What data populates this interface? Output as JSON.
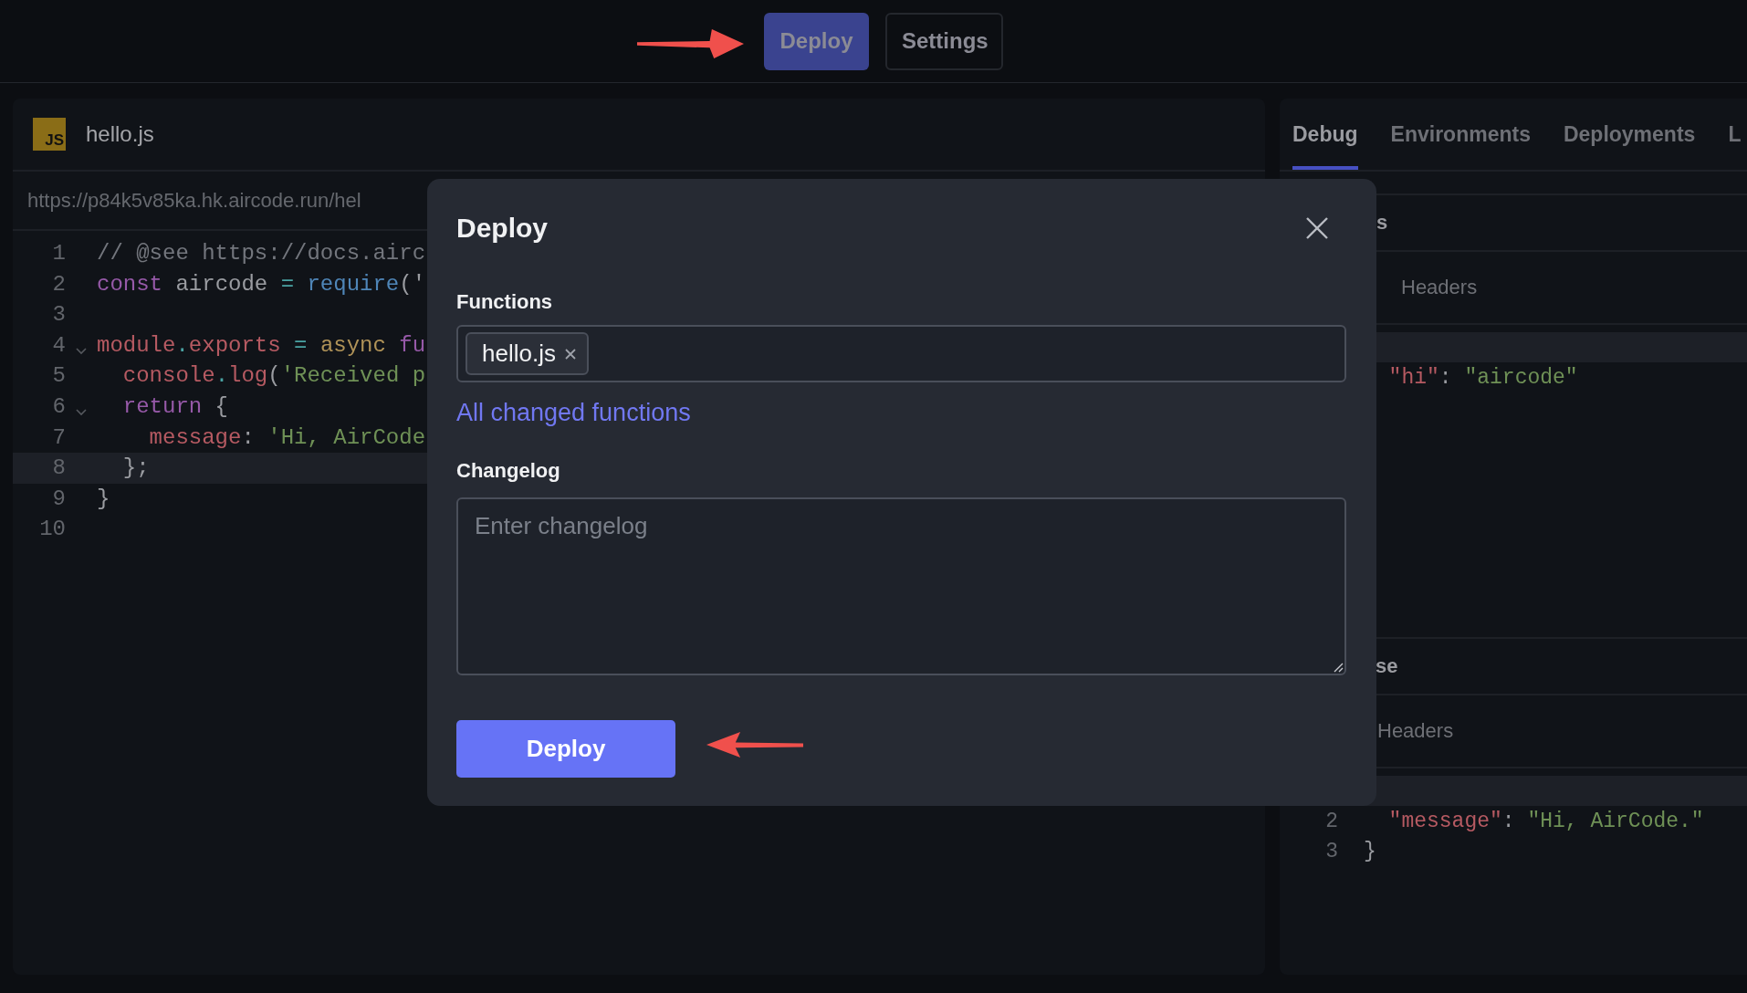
{
  "toolbar": {
    "buttons": [
      {
        "label": "Deploy",
        "kind": "primary"
      },
      {
        "label": "Settings",
        "kind": "secondary"
      }
    ]
  },
  "editor": {
    "file": {
      "icon_label": "JS",
      "name": "hello.js"
    },
    "url": "https://p84k5v85ka.hk.aircode.run/hel",
    "lines": [
      {
        "number": "1",
        "tokens": [
          {
            "text": "// @see https://docs.airc",
            "kind": "comment"
          }
        ]
      },
      {
        "number": "2",
        "tokens": [
          {
            "text": "const",
            "kind": "keyword"
          },
          {
            "text": " aircode ",
            "kind": "plain"
          },
          {
            "text": "= ",
            "kind": "operator"
          },
          {
            "text": "require",
            "kind": "call"
          },
          {
            "text": "('",
            "kind": "plain"
          }
        ]
      },
      {
        "number": "3"
      },
      {
        "number": "4",
        "fold": true,
        "tokens": [
          {
            "text": "module",
            "kind": "member"
          },
          {
            "text": ".",
            "kind": "operator"
          },
          {
            "text": "exports",
            "kind": "member"
          },
          {
            "text": " = ",
            "kind": "operator"
          },
          {
            "text": "async",
            "kind": "async"
          },
          {
            "text": " fu",
            "kind": "keyword"
          }
        ]
      },
      {
        "number": "5",
        "tokens": [
          {
            "text": "  console",
            "kind": "member"
          },
          {
            "text": ".",
            "kind": "operator"
          },
          {
            "text": "log",
            "kind": "member"
          },
          {
            "text": "(",
            "kind": "plain"
          },
          {
            "text": "'Received p",
            "kind": "string"
          }
        ]
      },
      {
        "number": "6",
        "fold": true,
        "tokens": [
          {
            "text": "  return",
            "kind": "keyword"
          },
          {
            "text": " {",
            "kind": "plain"
          }
        ]
      },
      {
        "number": "7",
        "tokens": [
          {
            "text": "    message",
            "kind": "member"
          },
          {
            "text": ": ",
            "kind": "plain"
          },
          {
            "text": "'Hi, AirCode",
            "kind": "string"
          }
        ]
      },
      {
        "number": "8",
        "active": true,
        "tokens": [
          {
            "text": "  };",
            "kind": "plain"
          }
        ]
      },
      {
        "number": "9",
        "tokens": [
          {
            "text": "}",
            "kind": "plain"
          }
        ]
      },
      {
        "number": "10"
      }
    ]
  },
  "side_panel": {
    "tabs": [
      {
        "label": "Debug",
        "selected": true
      },
      {
        "label": "Environments",
        "selected": false
      },
      {
        "label": "Deployments",
        "selected": false
      },
      {
        "label": "L",
        "selected": false
      }
    ],
    "request": {
      "section_title": "s",
      "subtab": "Headers",
      "lines": [
        {
          "active": true
        },
        {
          "tokens": [
            {
              "text": "  \"hi\"",
              "kind": "member"
            },
            {
              "text": ": ",
              "kind": "plain"
            },
            {
              "text": "\"aircode\"",
              "kind": "string"
            }
          ]
        }
      ]
    },
    "response": {
      "section_title": "se",
      "subtab": "Headers",
      "lines": [
        {
          "active": true
        },
        {
          "number": "2",
          "tokens": [
            {
              "text": "  \"message\"",
              "kind": "member"
            },
            {
              "text": ": ",
              "kind": "plain"
            },
            {
              "text": "\"Hi, AirCode.\"",
              "kind": "string"
            }
          ]
        },
        {
          "number": "3",
          "tokens": [
            {
              "text": "}",
              "kind": "plain"
            }
          ]
        }
      ]
    }
  },
  "dialog": {
    "title": "Deploy",
    "functions_label": "Functions",
    "selected_functions": [
      "hello.js"
    ],
    "link": "All changed functions",
    "changelog_label": "Changelog",
    "changelog_placeholder": "Enter changelog",
    "submit": "Deploy"
  }
}
